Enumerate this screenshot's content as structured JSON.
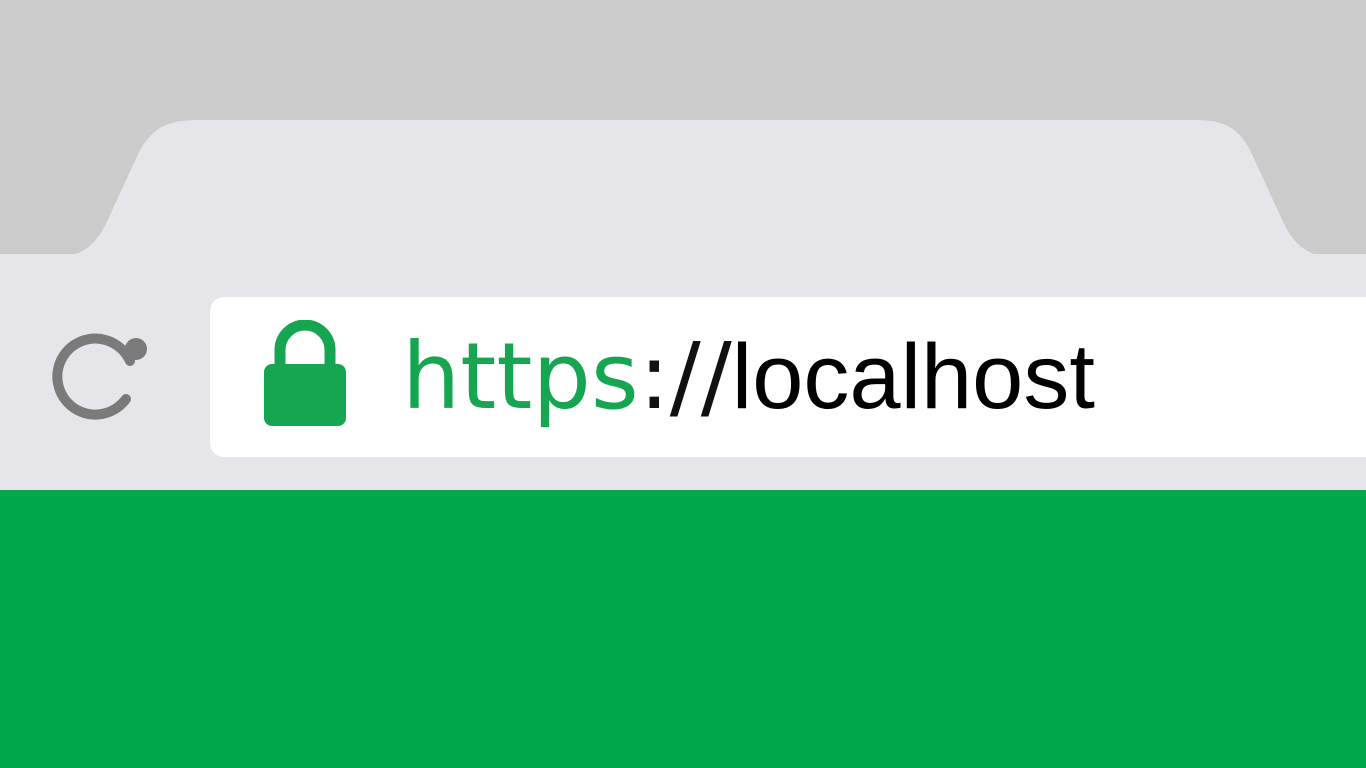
{
  "address_bar": {
    "scheme": "https",
    "separator": "://",
    "host": "localhost",
    "secure_icon": "lock-icon"
  },
  "toolbar": {
    "reload_icon": "reload-icon"
  },
  "colors": {
    "tab_strip": "#cbcbcb",
    "toolbar": "#e6e6ea",
    "omnibox": "#ffffff",
    "secure_green": "#16a651",
    "page_content": "#00aa4c",
    "reload_icon": "#7a7a7a"
  }
}
